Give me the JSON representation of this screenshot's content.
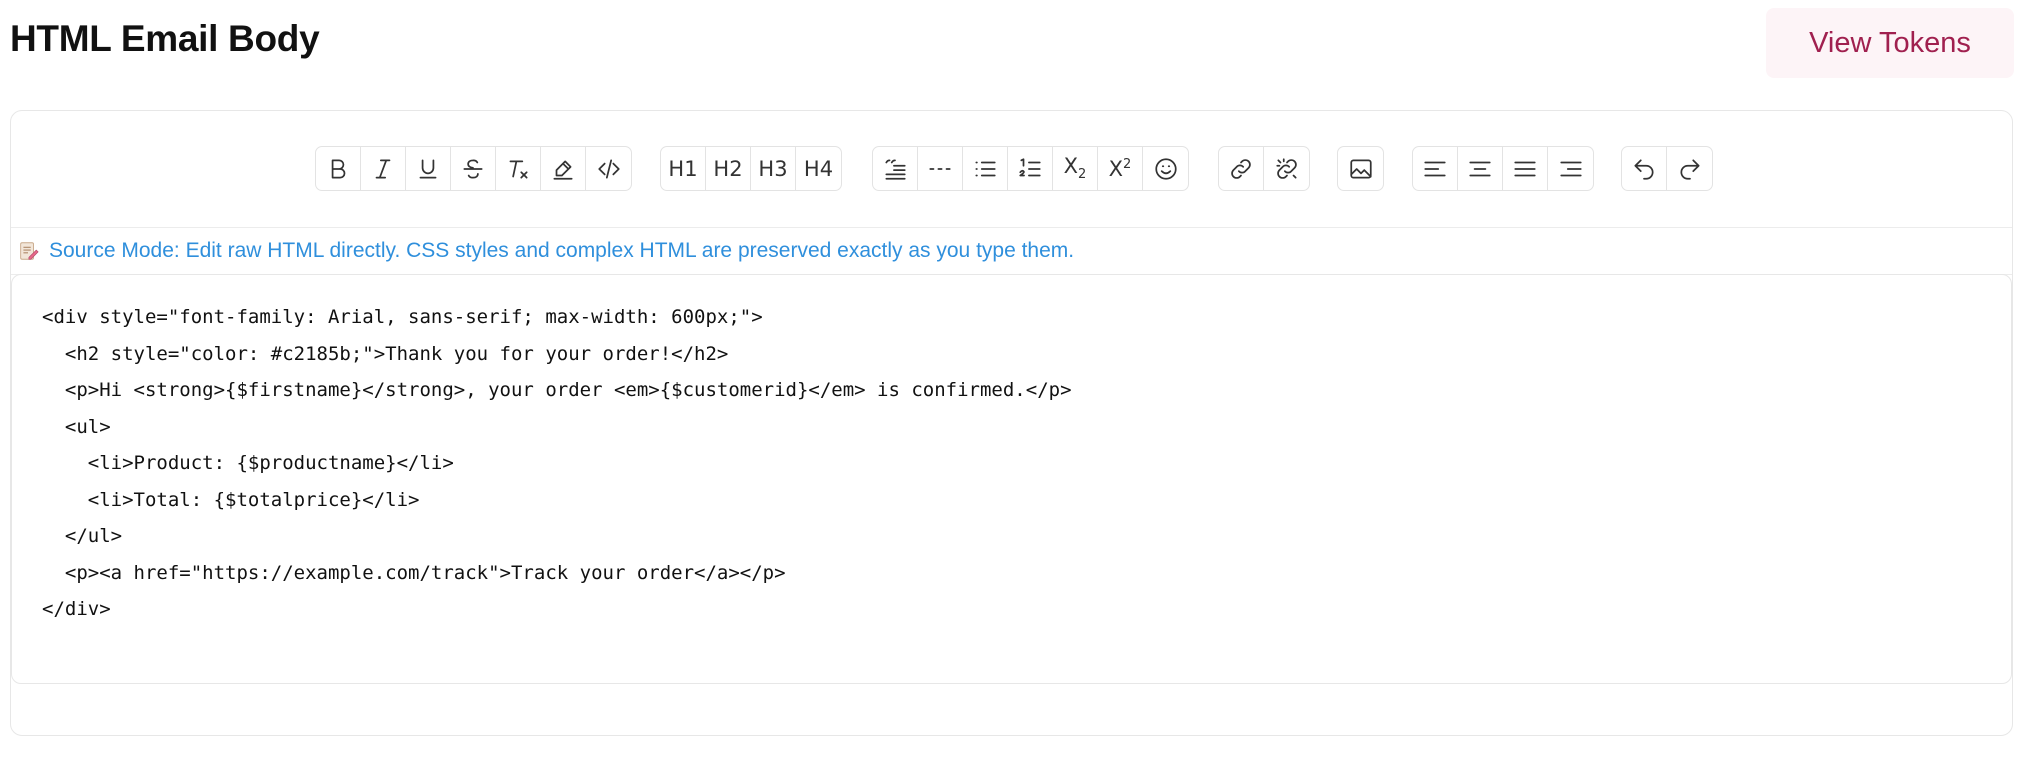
{
  "header": {
    "title": "HTML Email Body",
    "view_tokens_label": "View Tokens"
  },
  "toolbar": {
    "groups": [
      {
        "name": "formatting",
        "buttons": [
          "bold-icon",
          "italic-icon",
          "underline-icon",
          "strikethrough-icon",
          "clear-format-icon",
          "highlight-icon",
          "code-icon"
        ]
      },
      {
        "name": "headings",
        "buttons": [
          "H1",
          "H2",
          "H3",
          "H4"
        ]
      },
      {
        "name": "blocks",
        "buttons": [
          "blockquote-icon",
          "horizontal-rule-icon",
          "bullet-list-icon",
          "ordered-list-icon",
          "subscript-icon",
          "superscript-icon",
          "emoji-icon"
        ]
      },
      {
        "name": "links",
        "buttons": [
          "link-icon",
          "unlink-icon"
        ]
      },
      {
        "name": "media",
        "buttons": [
          "image-icon"
        ]
      },
      {
        "name": "alignment",
        "buttons": [
          "align-left-icon",
          "align-center-icon",
          "align-justify-icon",
          "align-right-icon"
        ]
      },
      {
        "name": "history",
        "buttons": [
          "undo-icon",
          "redo-icon"
        ]
      }
    ],
    "headings": {
      "h1": "H1",
      "h2": "H2",
      "h3": "H3",
      "h4": "H4"
    },
    "subscript": {
      "base": "X",
      "mark": "2"
    },
    "superscript": {
      "base": "X",
      "mark": "2"
    }
  },
  "notice": {
    "icon": "memo-icon",
    "text": "Source Mode: Edit raw HTML directly. CSS styles and complex HTML are preserved exactly as you type them.",
    "color": "#2f8fdc"
  },
  "source": {
    "lines": [
      "<div style=\"font-family: Arial, sans-serif; max-width: 600px;\">",
      "  <h2 style=\"color: #c2185b;\">Thank you for your order!</h2>",
      "  <p>Hi <strong>{$firstname}</strong>, your order <em>{$customerid}</em> is confirmed.</p>",
      "  <ul>",
      "    <li>Product: {$productname}</li>",
      "    <li>Total: {$totalprice}</li>",
      "  </ul>",
      "  <p><a href=\"https://example.com/track\">Track your order</a></p>",
      "</div>"
    ]
  },
  "colors": {
    "accent": "#a0204f",
    "accent_bg": "#fdf4f7"
  }
}
